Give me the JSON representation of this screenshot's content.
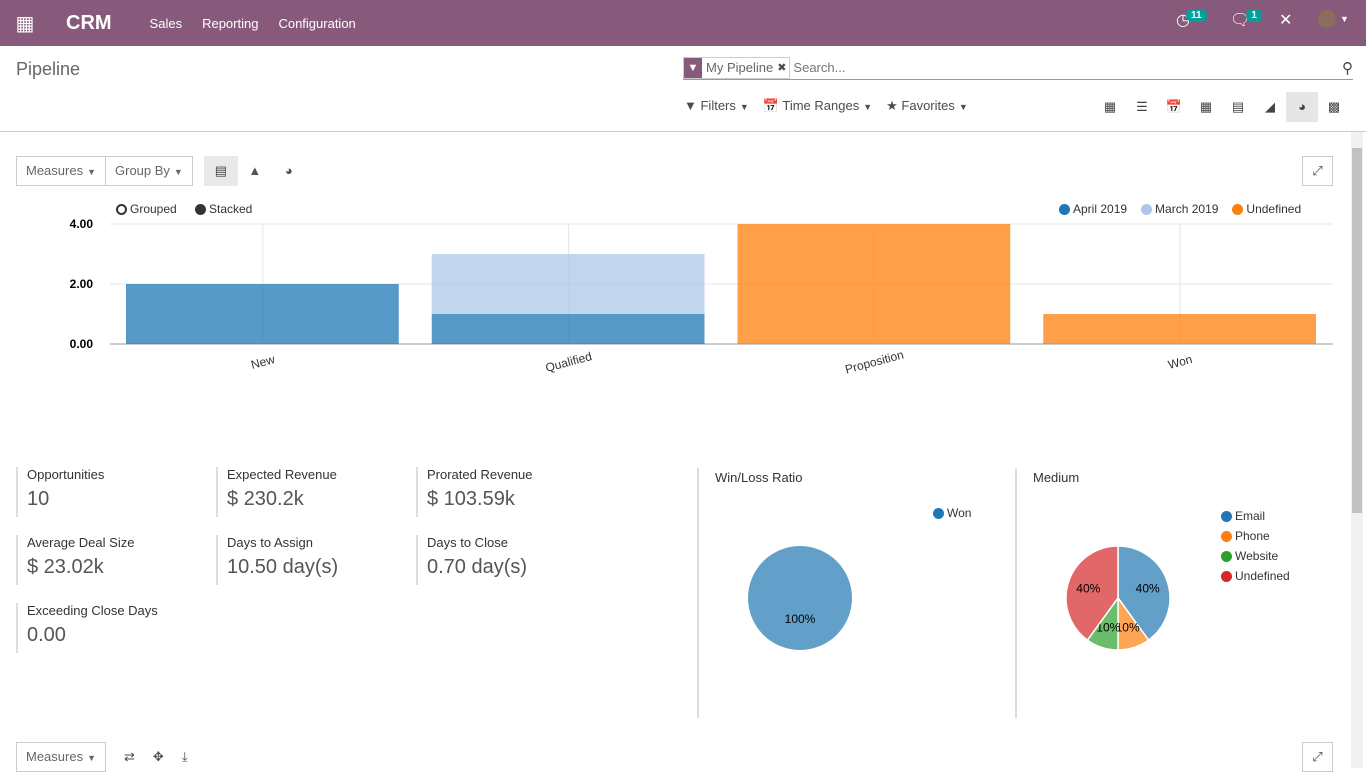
{
  "nav": {
    "app": "CRM",
    "menus": [
      "Sales",
      "Reporting",
      "Configuration"
    ],
    "activity_count": "11",
    "message_count": "1"
  },
  "control": {
    "title": "Pipeline",
    "facet": "My Pipeline",
    "search_placeholder": "Search...",
    "filters": "Filters",
    "time_ranges": "Time Ranges",
    "favorites": "Favorites",
    "active_view": "dashboard"
  },
  "graph": {
    "measures": "Measures",
    "group_by": "Group By",
    "grouped": "Grouped",
    "stacked": "Stacked",
    "mode": "stacked"
  },
  "chart_data": [
    {
      "type": "bar",
      "stacked": true,
      "categories": [
        "New",
        "Qualified",
        "Proposition",
        "Won"
      ],
      "series": [
        {
          "name": "April 2019",
          "color": "#1f77b4",
          "values": [
            2,
            1,
            0,
            0
          ]
        },
        {
          "name": "March 2019",
          "color": "#aec7e8",
          "values": [
            0,
            2,
            0,
            0
          ]
        },
        {
          "name": "Undefined",
          "color": "#ff7f0e",
          "values": [
            0,
            0,
            4,
            1
          ]
        }
      ],
      "ylim": [
        0,
        4
      ],
      "yticks": [
        "0.00",
        "2.00",
        "4.00"
      ],
      "legend": "top-right",
      "grid": true
    },
    {
      "type": "pie",
      "title": "Win/Loss Ratio",
      "categories": [
        "Won"
      ],
      "values": [
        100
      ],
      "labels": [
        "100%"
      ],
      "colors": [
        "#1f77b4"
      ]
    },
    {
      "type": "pie",
      "title": "Medium",
      "categories": [
        "Email",
        "Phone",
        "Website",
        "Undefined"
      ],
      "values": [
        40,
        10,
        10,
        40
      ],
      "labels": [
        "40%",
        "10%",
        "10%",
        "40%"
      ],
      "colors": [
        "#1f77b4",
        "#ff7f0e",
        "#2ca02c",
        "#d62728"
      ]
    }
  ],
  "kpis": [
    {
      "label": "Opportunities",
      "value": "10"
    },
    {
      "label": "Expected Revenue",
      "value": "$ 230.2k"
    },
    {
      "label": "Prorated Revenue",
      "value": "$ 103.59k"
    },
    {
      "label": "Average Deal Size",
      "value": "$ 23.02k"
    },
    {
      "label": "Days to Assign",
      "value": "10.50 day(s)"
    },
    {
      "label": "Days to Close",
      "value": "0.70 day(s)"
    },
    {
      "label": "Exceeding Close Days",
      "value": "0.00"
    }
  ],
  "pivot": {
    "measures": "Measures"
  }
}
